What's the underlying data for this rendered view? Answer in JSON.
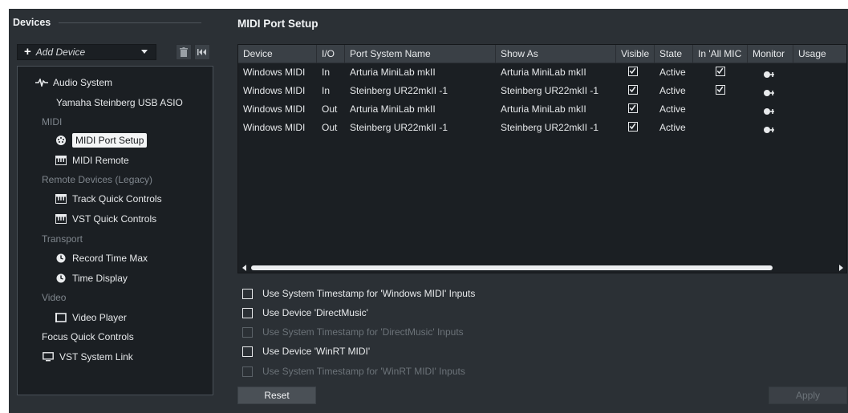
{
  "left": {
    "title": "Devices",
    "add_device": "Add Device",
    "tree": [
      {
        "label": "Audio System",
        "icon": "waveform-icon",
        "kind": "item"
      },
      {
        "label": "Yamaha Steinberg USB ASIO",
        "icon": "",
        "kind": "sub"
      },
      {
        "label": "MIDI",
        "icon": "",
        "kind": "category"
      },
      {
        "label": "MIDI Port Setup",
        "icon": "midi-port-icon",
        "kind": "item",
        "selected": true
      },
      {
        "label": "MIDI Remote",
        "icon": "keyboard-icon",
        "kind": "item"
      },
      {
        "label": "Remote Devices (Legacy)",
        "icon": "",
        "kind": "category"
      },
      {
        "label": "Track Quick Controls",
        "icon": "keyboard-icon",
        "kind": "item"
      },
      {
        "label": "VST Quick Controls",
        "icon": "keyboard-icon",
        "kind": "item"
      },
      {
        "label": "Transport",
        "icon": "",
        "kind": "category"
      },
      {
        "label": "Record Time Max",
        "icon": "clock-icon",
        "kind": "item"
      },
      {
        "label": "Time Display",
        "icon": "clock-icon",
        "kind": "item"
      },
      {
        "label": "Video",
        "icon": "",
        "kind": "category"
      },
      {
        "label": "Video Player",
        "icon": "video-frame-icon",
        "kind": "item"
      },
      {
        "label": "Focus Quick Controls",
        "icon": "",
        "kind": "top"
      },
      {
        "label": "VST System Link",
        "icon": "monitor-icon",
        "kind": "top"
      }
    ]
  },
  "right": {
    "title": "MIDI Port Setup",
    "columns": [
      "Device",
      "I/O",
      "Port System Name",
      "Show As",
      "Visible",
      "State",
      "In 'All MIC",
      "Monitor",
      "Usage"
    ],
    "rows": [
      {
        "device": "Windows MIDI",
        "io": "In",
        "port": "Arturia MiniLab mkII",
        "show_as": "Arturia MiniLab mkII",
        "visible": true,
        "state": "Active",
        "in_all": true,
        "monitor": true
      },
      {
        "device": "Windows MIDI",
        "io": "In",
        "port": "Steinberg UR22mkII -1",
        "show_as": "Steinberg UR22mkII -1",
        "visible": true,
        "state": "Active",
        "in_all": true,
        "monitor": true
      },
      {
        "device": "Windows MIDI",
        "io": "Out",
        "port": "Arturia MiniLab mkII",
        "show_as": "Arturia MiniLab mkII",
        "visible": true,
        "state": "Active",
        "in_all": false,
        "monitor": true
      },
      {
        "device": "Windows MIDI",
        "io": "Out",
        "port": "Steinberg UR22mkII -1",
        "show_as": "Steinberg UR22mkII -1",
        "visible": true,
        "state": "Active",
        "in_all": false,
        "monitor": true
      }
    ],
    "options": [
      {
        "label": "Use System Timestamp for 'Windows MIDI' Inputs",
        "enabled": true,
        "checked": false
      },
      {
        "label": "Use Device 'DirectMusic'",
        "enabled": true,
        "checked": false
      },
      {
        "label": "Use System Timestamp for 'DirectMusic' Inputs",
        "enabled": false,
        "checked": false
      },
      {
        "label": "Use Device 'WinRT MIDI'",
        "enabled": true,
        "checked": false
      },
      {
        "label": "Use System Timestamp for 'WinRT MIDI' Inputs",
        "enabled": false,
        "checked": false
      }
    ],
    "reset_label": "Reset",
    "apply_label": "Apply"
  },
  "colors": {
    "panel_bg": "#2b3035",
    "list_bg": "#1b1f23",
    "header_bg": "#3a4046",
    "text": "#e6e8ea",
    "muted": "#7f868d"
  }
}
